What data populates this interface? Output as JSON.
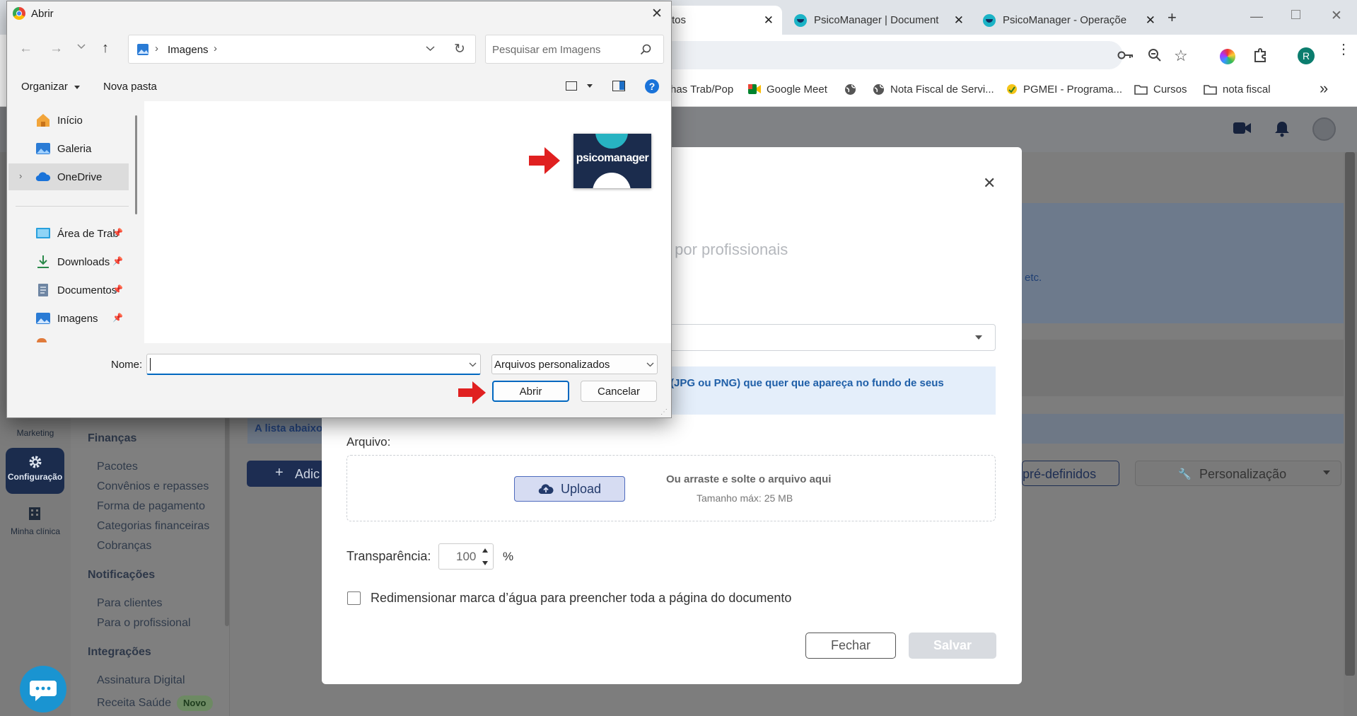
{
  "browser": {
    "tabs": [
      {
        "label": "tos",
        "active": true
      },
      {
        "label": "PsicoManager | Document",
        "active": false
      },
      {
        "label": "PsicoManager - Operaçõe",
        "active": false
      }
    ],
    "new_tab": "+",
    "bookmarks": [
      "has Trab/Pop",
      "Google Meet",
      "Nota Fiscal de Servi...",
      "PGMEI - Programa...",
      "Cursos",
      "nota fiscal"
    ],
    "profile_initial": "R",
    "more_bookmarks": "»"
  },
  "sidebar": {
    "rail": {
      "marketing": "Marketing",
      "config": "Configuração",
      "clinic": "Minha clínica"
    },
    "sections": [
      {
        "title": "Finanças",
        "items": [
          "Pacotes",
          "Convênios e repasses",
          "Forma de pagamento",
          "Categorias financeiras",
          "Cobranças"
        ]
      },
      {
        "title": "Notificações",
        "items": [
          "Para clientes",
          "Para o profissional"
        ]
      },
      {
        "title": "Integrações",
        "items": [
          "Assinatura Digital",
          "Receita Saúde"
        ]
      }
    ],
    "new_badge": "Novo"
  },
  "page": {
    "list_notice": "A lista abaixo",
    "add_button": "Adic",
    "predefined_button": "pré-definidos",
    "customize_button": "Personalização",
    "banner_tail": "etc."
  },
  "modal": {
    "subtitle_tail": "s por profissionais",
    "info_text": "(JPG ou PNG) que quer que apareça no fundo de seus",
    "file_label": "Arquivo:",
    "upload_button": "Upload",
    "drop_text": "Ou arraste e solte o arquivo aqui",
    "max_size": "Tamanho máx: 25 MB",
    "transparency_label": "Transparência:",
    "transparency_value": "100",
    "percent": "%",
    "resize_label": "Redimensionar marca d’água para preencher toda a página do documento",
    "resize_checked": false,
    "close_button": "Fechar",
    "save_button": "Salvar"
  },
  "dialog": {
    "title": "Abrir",
    "breadcrumb": "Imagens",
    "search_placeholder": "Pesquisar em Imagens",
    "organize": "Organizar",
    "new_folder": "Nova pasta",
    "nav": {
      "inicio": "Início",
      "galeria": "Galeria",
      "onedrive": "OneDrive",
      "desktop": "Área de Trab",
      "downloads": "Downloads",
      "documentos": "Documentos",
      "imagens": "Imagens"
    },
    "file_thumb_text": "psicomanager",
    "name_label": "Nome:",
    "name_value": "",
    "filter": "Arquivos personalizados",
    "open_button": "Abrir",
    "cancel_button": "Cancelar"
  },
  "colors": {
    "accent": "#0067c0",
    "brand_navy": "#1b2c4d",
    "brand_teal": "#27b3c2",
    "arrow_red": "#e02020"
  }
}
